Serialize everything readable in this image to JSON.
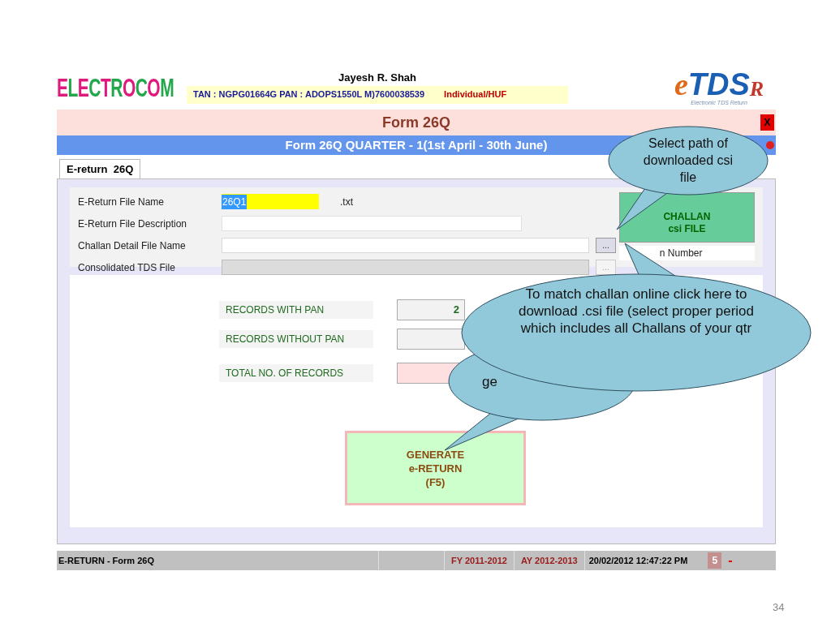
{
  "header": {
    "logo": "ELECTROCOM",
    "name": "Jayesh R. Shah",
    "info": "TAN : NGPG01664G  PAN : ADOPS1550L  M)7600038539",
    "category": "Individual/HUF",
    "brand": {
      "mark": "e",
      "main": "TDS",
      "suffix": "R",
      "tagline": "Electronic TDS Return"
    }
  },
  "window": {
    "title": "Form 26Q",
    "close": "X",
    "subtitle": "Form 26Q QUARTER - 1(1st April - 30th June)"
  },
  "tabs": [
    {
      "label": "E-return  26Q",
      "selected": true
    }
  ],
  "fields": [
    {
      "label": "E-Return File Name",
      "kind": "highlight",
      "value": "26Q1",
      "value_selected": true,
      "suffix": ".txt"
    },
    {
      "label": "E-Return File Description",
      "kind": "text"
    },
    {
      "label": "Challan Detail File Name",
      "kind": "browse",
      "button": "...",
      "disabled": false
    },
    {
      "label": "Consolidated TDS File",
      "kind": "browse",
      "button": "...",
      "disabled": true
    }
  ],
  "download_button": {
    "lines": [
      "CHALLAN",
      "csi FILE"
    ]
  },
  "challan_number_label": "n Number",
  "records": [
    {
      "label": "RECORDS WITH PAN",
      "kind": "normal",
      "value": "2"
    },
    {
      "label": "RECORDS WITHOUT PAN",
      "kind": "normal"
    },
    {
      "label": "TOTAL NO. OF RECORDS",
      "kind": "total"
    }
  ],
  "generate_button": [
    "GENERATE",
    "e-RETURN",
    "(F5)"
  ],
  "status_bar": {
    "left": "E-RETURN - Form 26Q",
    "fy": "FY 2011-2012",
    "ay": "AY 2012-2013",
    "datetime": "20/02/2012 12:47:22 PM",
    "badge": "5",
    "minimize": "-"
  },
  "callouts": [
    {
      "text": "Select path of downloaded csi file"
    },
    {
      "text": "To match challan online click here to download .csi file (select proper period which includes all Challans of your qtr"
    },
    {
      "text": "ge"
    }
  ],
  "slide_number": "34"
}
